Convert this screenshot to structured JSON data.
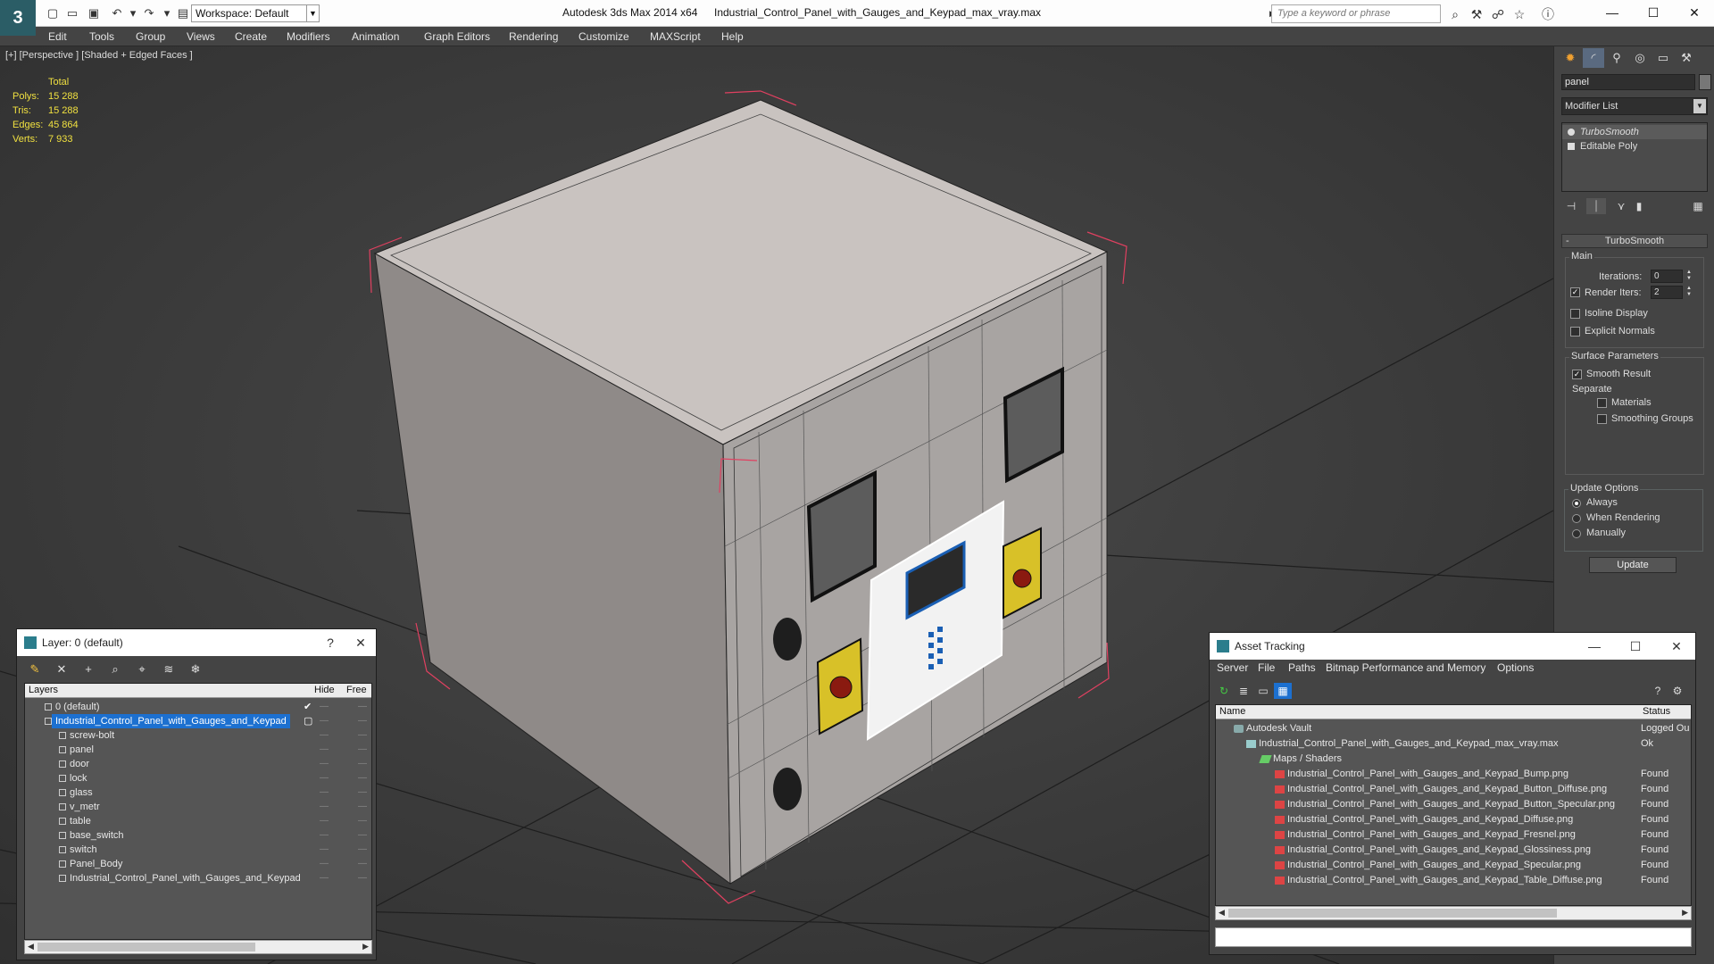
{
  "titlebar": {
    "workspace": "Workspace: Default",
    "app_title": "Autodesk 3ds Max  2014 x64",
    "file_title": "Industrial_Control_Panel_with_Gauges_and_Keypad_max_vray.max",
    "search_placeholder": "Type a keyword or phrase"
  },
  "menubar": {
    "items": [
      "Edit",
      "Tools",
      "Group",
      "Views",
      "Create",
      "Modifiers",
      "Animation",
      "Graph Editors",
      "Rendering",
      "Customize",
      "MAXScript",
      "Help"
    ]
  },
  "viewport": {
    "label": "[+] [Perspective ] [Shaded + Edged Faces ]",
    "stats": {
      "header": "Total",
      "polys_label": "Polys:",
      "polys": "15 288",
      "tris_label": "Tris:",
      "tris": "15 288",
      "edges_label": "Edges:",
      "edges": "45 864",
      "verts_label": "Verts:",
      "verts": "7 933"
    }
  },
  "command_panel": {
    "object_name": "panel",
    "modifier_list": "Modifier List",
    "stack": [
      "TurboSmooth",
      "Editable Poly"
    ],
    "rollout_title": "TurboSmooth",
    "main_group": "Main",
    "iterations_label": "Iterations:",
    "iterations": "0",
    "render_iters_label": "Render Iters:",
    "render_iters": "2",
    "isoline_display": "Isoline Display",
    "explicit_normals": "Explicit Normals",
    "surface_params": "Surface Parameters",
    "smooth_result": "Smooth Result",
    "separate": "Separate",
    "materials": "Materials",
    "smoothing_groups": "Smoothing Groups",
    "update_options": "Update Options",
    "always": "Always",
    "when_rendering": "When Rendering",
    "manually": "Manually",
    "update_button": "Update"
  },
  "layer_window": {
    "title": "Layer: 0 (default)",
    "help": "?",
    "columns": [
      "Layers",
      "Hide",
      "Free"
    ],
    "rows": [
      {
        "name": "0 (default)",
        "level": 0
      },
      {
        "name": "Industrial_Control_Panel_with_Gauges_and_Keypad",
        "level": 0
      },
      {
        "name": "screw-bolt",
        "level": 1
      },
      {
        "name": "panel",
        "level": 1
      },
      {
        "name": "door",
        "level": 1
      },
      {
        "name": "lock",
        "level": 1
      },
      {
        "name": "glass",
        "level": 1
      },
      {
        "name": "v_metr",
        "level": 1
      },
      {
        "name": "table",
        "level": 1
      },
      {
        "name": "base_switch",
        "level": 1
      },
      {
        "name": "switch",
        "level": 1
      },
      {
        "name": "Panel_Body",
        "level": 1
      },
      {
        "name": "Industrial_Control_Panel_with_Gauges_and_Keypad",
        "level": 1
      }
    ]
  },
  "asset_window": {
    "title": "Asset Tracking",
    "menu": [
      "Server",
      "File",
      "Paths",
      "Bitmap Performance and Memory",
      "Options"
    ],
    "columns": [
      "Name",
      "Status"
    ],
    "rows": [
      {
        "name": "Autodesk Vault",
        "status": "Logged Ou",
        "level": 0,
        "icon": "vault"
      },
      {
        "name": "Industrial_Control_Panel_with_Gauges_and_Keypad_max_vray.max",
        "status": "Ok",
        "level": 1,
        "icon": "file"
      },
      {
        "name": "Maps / Shaders",
        "status": "",
        "level": 2,
        "icon": "folder"
      },
      {
        "name": "Industrial_Control_Panel_with_Gauges_and_Keypad_Bump.png",
        "status": "Found",
        "level": 3,
        "icon": "png"
      },
      {
        "name": "Industrial_Control_Panel_with_Gauges_and_Keypad_Button_Diffuse.png",
        "status": "Found",
        "level": 3,
        "icon": "png"
      },
      {
        "name": "Industrial_Control_Panel_with_Gauges_and_Keypad_Button_Specular.png",
        "status": "Found",
        "level": 3,
        "icon": "png"
      },
      {
        "name": "Industrial_Control_Panel_with_Gauges_and_Keypad_Diffuse.png",
        "status": "Found",
        "level": 3,
        "icon": "png"
      },
      {
        "name": "Industrial_Control_Panel_with_Gauges_and_Keypad_Fresnel.png",
        "status": "Found",
        "level": 3,
        "icon": "png"
      },
      {
        "name": "Industrial_Control_Panel_with_Gauges_and_Keypad_Glossiness.png",
        "status": "Found",
        "level": 3,
        "icon": "png"
      },
      {
        "name": "Industrial_Control_Panel_with_Gauges_and_Keypad_Specular.png",
        "status": "Found",
        "level": 3,
        "icon": "png"
      },
      {
        "name": "Industrial_Control_Panel_with_Gauges_and_Keypad_Table_Diffuse.png",
        "status": "Found",
        "level": 3,
        "icon": "png"
      }
    ]
  },
  "colors": {
    "accent": "#1c70d0",
    "stats_text": "#f0e040",
    "viewport_bg": "#3a3a3a",
    "panel_bg": "#444444"
  }
}
